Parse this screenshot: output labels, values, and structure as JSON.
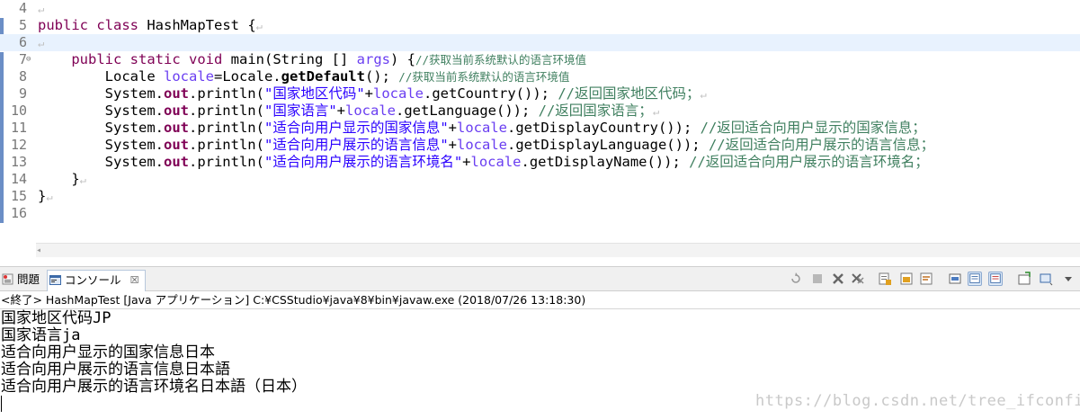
{
  "editor": {
    "line_numbers": [
      "4",
      "5",
      "6",
      "7",
      "8",
      "9",
      "10",
      "11",
      "12",
      "13",
      "14",
      "15",
      "16"
    ],
    "lines": [
      {
        "segments": [
          {
            "t": "↵",
            "c": "ws"
          }
        ]
      },
      {
        "segments": [
          {
            "t": "public",
            "c": "kw"
          },
          {
            "t": " ",
            "c": ""
          },
          {
            "t": "class",
            "c": "kw"
          },
          {
            "t": " HashMapTest {",
            "c": ""
          },
          {
            "t": "↵",
            "c": "ws"
          }
        ]
      },
      {
        "segments": [
          {
            "t": "↵",
            "c": "ws"
          }
        ]
      },
      {
        "segments": [
          {
            "t": "    ",
            "c": ""
          },
          {
            "t": "public",
            "c": "kw"
          },
          {
            "t": " ",
            "c": ""
          },
          {
            "t": "static",
            "c": "kw"
          },
          {
            "t": " ",
            "c": ""
          },
          {
            "t": "void",
            "c": "kw"
          },
          {
            "t": " main(String [] ",
            "c": ""
          },
          {
            "t": "args",
            "c": "loc"
          },
          {
            "t": ") {",
            "c": ""
          },
          {
            "t": "//获取当前系统默认的语言环境值",
            "c": "cmt small"
          }
        ]
      },
      {
        "segments": [
          {
            "t": "        Locale ",
            "c": ""
          },
          {
            "t": "locale",
            "c": "loc"
          },
          {
            "t": "=Locale.",
            "c": ""
          },
          {
            "t": "getDefault",
            "c": "bold"
          },
          {
            "t": "(); ",
            "c": ""
          },
          {
            "t": "//获取当前系统默认的语言环境值",
            "c": "cmt small"
          }
        ]
      },
      {
        "segments": [
          {
            "t": "        System.",
            "c": ""
          },
          {
            "t": "out",
            "c": "fld"
          },
          {
            "t": ".println(",
            "c": ""
          },
          {
            "t": "\"国家地区代码\"",
            "c": "str"
          },
          {
            "t": "+",
            "c": ""
          },
          {
            "t": "locale",
            "c": "loc"
          },
          {
            "t": ".getCountry()); ",
            "c": ""
          },
          {
            "t": "//返回国家地区代码；",
            "c": "cmt"
          },
          {
            "t": "↵",
            "c": "ws"
          }
        ]
      },
      {
        "segments": [
          {
            "t": "        System.",
            "c": ""
          },
          {
            "t": "out",
            "c": "fld"
          },
          {
            "t": ".println(",
            "c": ""
          },
          {
            "t": "\"国家语言\"",
            "c": "str"
          },
          {
            "t": "+",
            "c": ""
          },
          {
            "t": "locale",
            "c": "loc"
          },
          {
            "t": ".getLanguage()); ",
            "c": ""
          },
          {
            "t": "//返回国家语言；",
            "c": "cmt"
          },
          {
            "t": "↵",
            "c": "ws"
          }
        ]
      },
      {
        "segments": [
          {
            "t": "        System.",
            "c": ""
          },
          {
            "t": "out",
            "c": "fld"
          },
          {
            "t": ".println(",
            "c": ""
          },
          {
            "t": "\"适合向用户显示的国家信息\"",
            "c": "str"
          },
          {
            "t": "+",
            "c": ""
          },
          {
            "t": "locale",
            "c": "loc"
          },
          {
            "t": ".getDisplayCountry()); ",
            "c": ""
          },
          {
            "t": "//返回适合向用户显示的国家信息；",
            "c": "cmt"
          }
        ]
      },
      {
        "segments": [
          {
            "t": "        System.",
            "c": ""
          },
          {
            "t": "out",
            "c": "fld"
          },
          {
            "t": ".println(",
            "c": ""
          },
          {
            "t": "\"适合向用户展示的语言信息\"",
            "c": "str"
          },
          {
            "t": "+",
            "c": ""
          },
          {
            "t": "locale",
            "c": "loc"
          },
          {
            "t": ".getDisplayLanguage()); ",
            "c": ""
          },
          {
            "t": "//返回适合向用户展示的语言信息；",
            "c": "cmt"
          }
        ]
      },
      {
        "segments": [
          {
            "t": "        System.",
            "c": ""
          },
          {
            "t": "out",
            "c": "fld"
          },
          {
            "t": ".println(",
            "c": ""
          },
          {
            "t": "\"适合向用户展示的语言环境名\"",
            "c": "str"
          },
          {
            "t": "+",
            "c": ""
          },
          {
            "t": "locale",
            "c": "loc"
          },
          {
            "t": ".getDisplayName()); ",
            "c": ""
          },
          {
            "t": "//返回适合向用户展示的语言环境名；",
            "c": "cmt"
          }
        ]
      },
      {
        "segments": [
          {
            "t": "    }",
            "c": ""
          },
          {
            "t": "↵",
            "c": "ws"
          }
        ]
      },
      {
        "segments": [
          {
            "t": "}",
            "c": ""
          },
          {
            "t": "↵",
            "c": "ws"
          }
        ]
      },
      {
        "segments": []
      }
    ]
  },
  "console_view": {
    "tabs": [
      {
        "label": "問題",
        "icon": "problems-icon"
      },
      {
        "label": "コンソール",
        "icon": "console-icon",
        "close": "☒"
      }
    ],
    "toolbar_icons": [
      "remove-launch-icon",
      "terminate-icon",
      "remove-icon",
      "remove-all-icon",
      "clear-console-icon",
      "scroll-lock-icon",
      "word-wrap-icon",
      "pin-console-icon",
      "show-on-output-icon",
      "show-on-error-icon",
      "open-console-icon",
      "display-console-icon",
      "view-menu-icon"
    ],
    "header": "<終了> HashMapTest [Java アプリケーション] C:¥CSStudio¥java¥8¥bin¥javaw.exe (2018/07/26 13:18:30)",
    "output_lines": [
      "国家地区代码JP",
      "国家语言ja",
      "适合向用户显示的国家信息日本",
      "适合向用户展示的语言信息日本語",
      "适合向用户展示的语言环境名日本語（日本）"
    ],
    "watermark": "https://blog.csdn.net/tree_ifconfig"
  }
}
